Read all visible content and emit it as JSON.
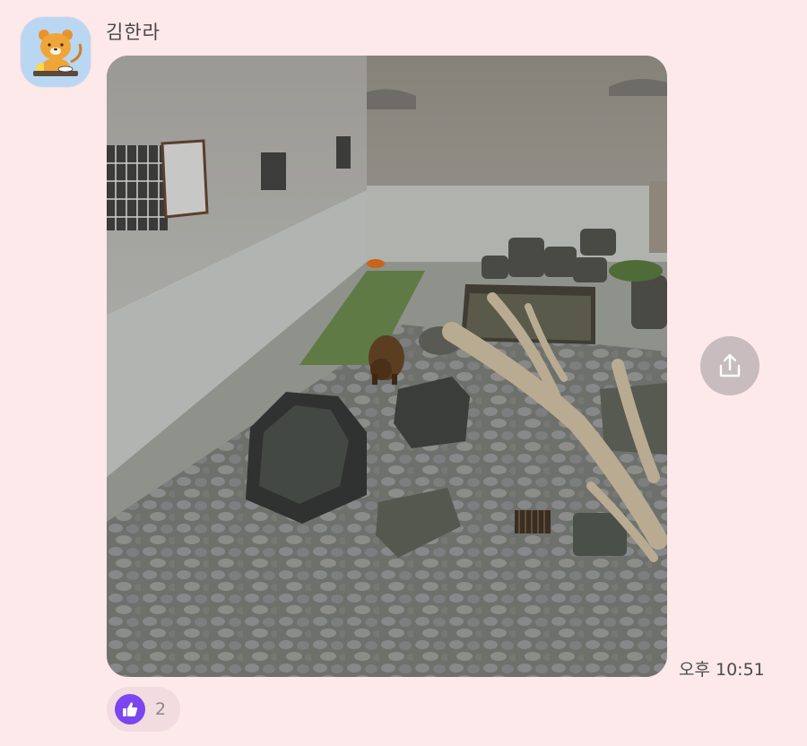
{
  "message": {
    "sender_name": "김한라",
    "avatar_icon": "lion-character-icon",
    "photo_description_icon": "bear-enclosure-photo",
    "timestamp": "오후 10:51",
    "share_icon": "share-icon",
    "reaction": {
      "icon": "thumbs-up-icon",
      "count": "2",
      "color": "#7b45f0"
    }
  },
  "colors": {
    "background": "#fde8ea",
    "avatar_bg": "#b9d7f2",
    "share_button": "#c9bcbe",
    "reaction_pill": "#f3dce0"
  }
}
